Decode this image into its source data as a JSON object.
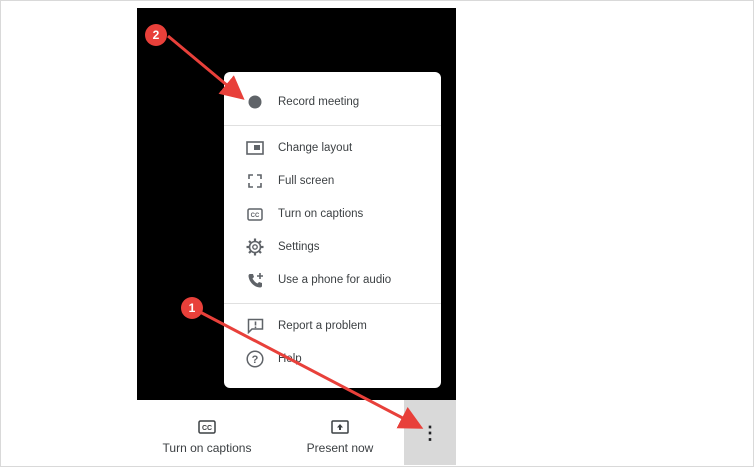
{
  "menu": {
    "items": [
      {
        "label": "Record meeting",
        "icon": "record-dot-icon"
      },
      {
        "label": "Change layout",
        "icon": "layout-icon"
      },
      {
        "label": "Full screen",
        "icon": "fullscreen-icon"
      },
      {
        "label": "Turn on captions",
        "icon": "captions-icon"
      },
      {
        "label": "Settings",
        "icon": "gear-icon"
      },
      {
        "label": "Use a phone for audio",
        "icon": "phone-icon"
      },
      {
        "label": "Report a problem",
        "icon": "report-icon"
      },
      {
        "label": "Help",
        "icon": "help-icon"
      }
    ]
  },
  "bottom_bar": {
    "captions_label": "Turn on captions",
    "present_label": "Present now",
    "more_label": "⋮"
  },
  "annotations": {
    "step1": "1",
    "step2": "2",
    "arrow_color": "#e8403a"
  }
}
